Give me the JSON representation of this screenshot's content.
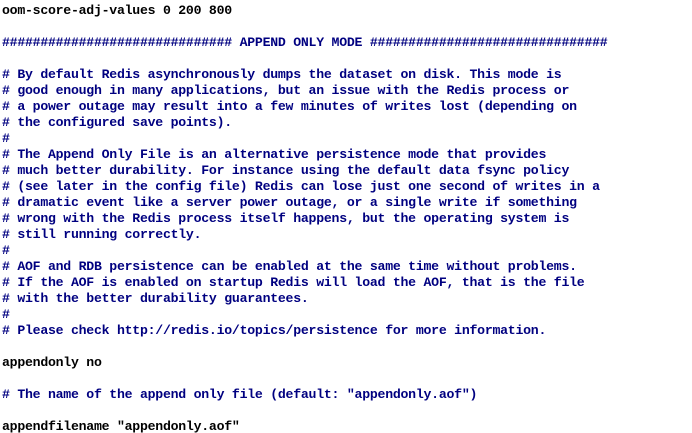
{
  "colors": {
    "background": "#ffffff",
    "comment_text": "#000080",
    "directive_text": "#000000"
  },
  "lines": [
    {
      "kind": "directive",
      "text": "oom-score-adj-values 0 200 800"
    },
    {
      "kind": "blank",
      "text": ""
    },
    {
      "kind": "comment",
      "text": "############################## APPEND ONLY MODE ###############################"
    },
    {
      "kind": "blank",
      "text": ""
    },
    {
      "kind": "comment",
      "text": "# By default Redis asynchronously dumps the dataset on disk. This mode is"
    },
    {
      "kind": "comment",
      "text": "# good enough in many applications, but an issue with the Redis process or"
    },
    {
      "kind": "comment",
      "text": "# a power outage may result into a few minutes of writes lost (depending on"
    },
    {
      "kind": "comment",
      "text": "# the configured save points)."
    },
    {
      "kind": "comment",
      "text": "#"
    },
    {
      "kind": "comment",
      "text": "# The Append Only File is an alternative persistence mode that provides"
    },
    {
      "kind": "comment",
      "text": "# much better durability. For instance using the default data fsync policy"
    },
    {
      "kind": "comment",
      "text": "# (see later in the config file) Redis can lose just one second of writes in a"
    },
    {
      "kind": "comment",
      "text": "# dramatic event like a server power outage, or a single write if something"
    },
    {
      "kind": "comment",
      "text": "# wrong with the Redis process itself happens, but the operating system is"
    },
    {
      "kind": "comment",
      "text": "# still running correctly."
    },
    {
      "kind": "comment",
      "text": "#"
    },
    {
      "kind": "comment",
      "text": "# AOF and RDB persistence can be enabled at the same time without problems."
    },
    {
      "kind": "comment",
      "text": "# If the AOF is enabled on startup Redis will load the AOF, that is the file"
    },
    {
      "kind": "comment",
      "text": "# with the better durability guarantees."
    },
    {
      "kind": "comment",
      "text": "#"
    },
    {
      "kind": "comment",
      "text": "# Please check http://redis.io/topics/persistence for more information."
    },
    {
      "kind": "blank",
      "text": ""
    },
    {
      "kind": "directive",
      "text": "appendonly no"
    },
    {
      "kind": "blank",
      "text": ""
    },
    {
      "kind": "comment",
      "text": "# The name of the append only file (default: \"appendonly.aof\")"
    },
    {
      "kind": "blank",
      "text": ""
    },
    {
      "kind": "directive",
      "text": "appendfilename \"appendonly.aof\""
    }
  ]
}
